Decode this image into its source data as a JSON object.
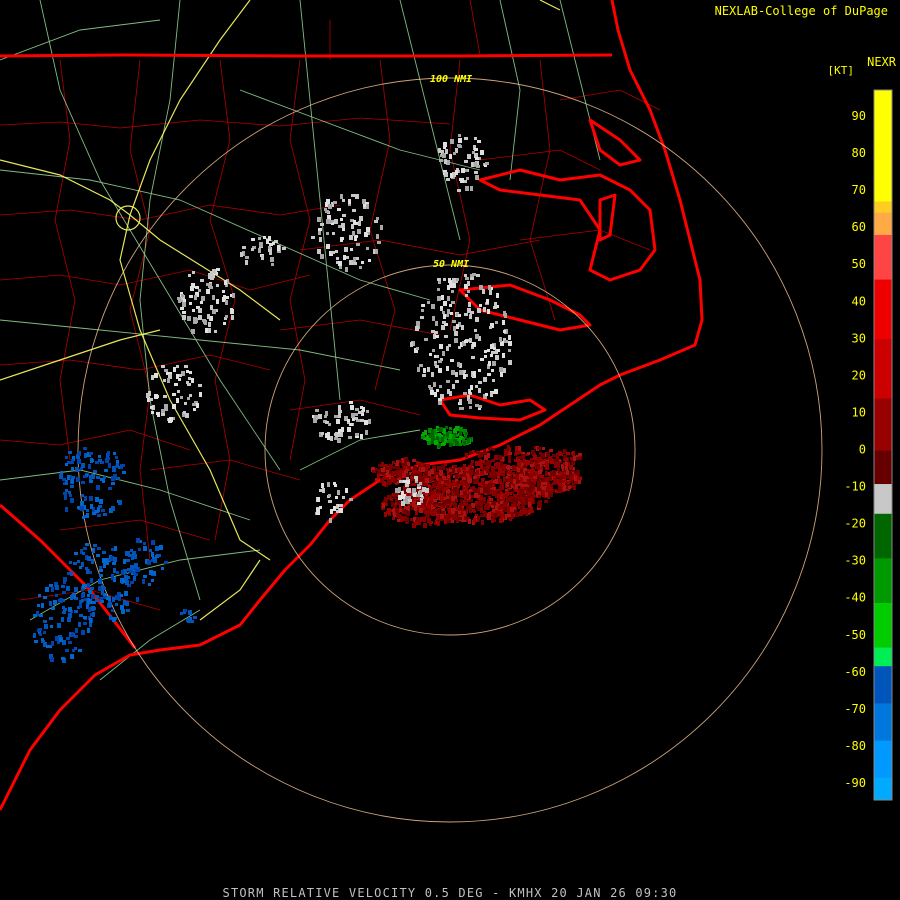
{
  "header": {
    "credit": "NEXLAB-College of DuPage",
    "product": "NEXR",
    "units": "[KT]"
  },
  "footer": {
    "caption": "STORM RELATIVE VELOCITY 0.5 DEG - KMHX 20 JAN 26 09:30"
  },
  "range_rings": {
    "inner_label": "50 NMI",
    "outer_label": "100 NMI"
  },
  "legend": {
    "ticks": [
      "90",
      "80",
      "70",
      "60",
      "50",
      "40",
      "30",
      "20",
      "10",
      "0",
      "-10",
      "-20",
      "-30",
      "-40",
      "-50",
      "-60",
      "-70",
      "-80",
      "-90"
    ],
    "bands": [
      {
        "color": "#ffff00"
      },
      {
        "color": "#ffcc22"
      },
      {
        "color": "#ffaa44"
      },
      {
        "color": "#ff4444"
      },
      {
        "color": "#ee0000"
      },
      {
        "color": "#cc0000"
      },
      {
        "color": "#990000"
      },
      {
        "color": "#660000"
      },
      {
        "color": "#c8c8c8"
      },
      {
        "color": "#006600"
      },
      {
        "color": "#009900"
      },
      {
        "color": "#00cc00"
      },
      {
        "color": "#00ee55"
      },
      {
        "color": "#0055bb"
      },
      {
        "color": "#0077dd"
      },
      {
        "color": "#0099ff"
      },
      {
        "color": "#00aaff"
      }
    ]
  },
  "colors": {
    "state_border": "#ff0000",
    "county_lines": "#cc0000",
    "highways": "#ffff66",
    "roads": "#99dd99",
    "rings": "#ffcc99"
  }
}
